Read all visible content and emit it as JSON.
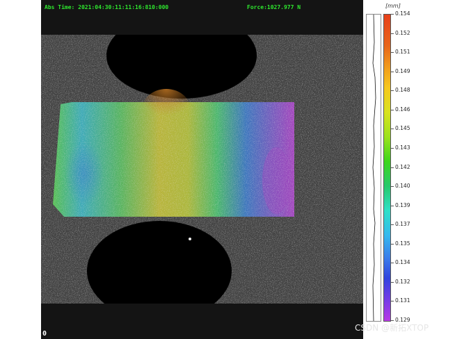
{
  "hud": {
    "abs_time": "Abs Time: 2021:04:30:11:11:16:810:000",
    "force": "Force:1027.977 N",
    "frame_number": "0"
  },
  "colorbar": {
    "unit": "[mm]",
    "ticks": [
      "0.154",
      "0.152",
      "0.151",
      "0.149",
      "0.148",
      "0.146",
      "0.145",
      "0.143",
      "0.142",
      "0.140",
      "0.139",
      "0.137",
      "0.135",
      "0.134",
      "0.132",
      "0.131",
      "0.129"
    ]
  },
  "colors": {
    "hud_text": "#2ee82e",
    "background": "#141414"
  },
  "watermark": "CSDN @新拓XTOP"
}
